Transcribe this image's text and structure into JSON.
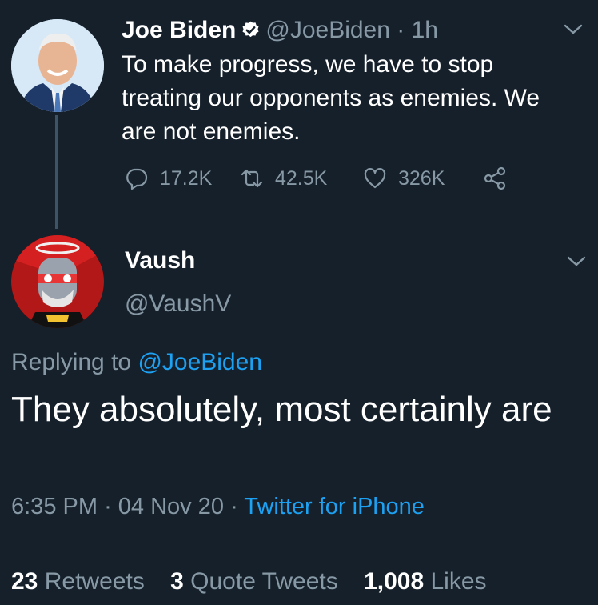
{
  "parent_tweet": {
    "name": "Joe Biden",
    "handle": "@JoeBiden",
    "separator": "·",
    "time": "1h",
    "text": "To make progress, we have to stop treating our opponents as enemies. We are not enemies.",
    "replies": "17.2K",
    "retweets": "42.5K",
    "likes": "326K",
    "icons": [
      "reply-icon",
      "retweet-icon",
      "like-icon",
      "share-icon",
      "verified-badge-icon",
      "chevron-down-icon"
    ]
  },
  "reply_tweet": {
    "name": "Vaush",
    "handle": "@VaushV",
    "replying_prefix": "Replying to",
    "replying_to": "@JoeBiden",
    "text": "They absolutely, most certainly are",
    "time": "6:35 PM",
    "date": "04 Nov 20",
    "dot": "·",
    "source": "Twitter for iPhone",
    "stats": {
      "retweets_count": "23",
      "retweets_label": "Retweets",
      "quotes_count": "3",
      "quotes_label": "Quote Tweets",
      "likes_count": "1,008",
      "likes_label": "Likes"
    }
  },
  "colors": {
    "background": "#15202b",
    "muted": "#8899a6",
    "link": "#1da1f2",
    "divider": "#38444d"
  }
}
